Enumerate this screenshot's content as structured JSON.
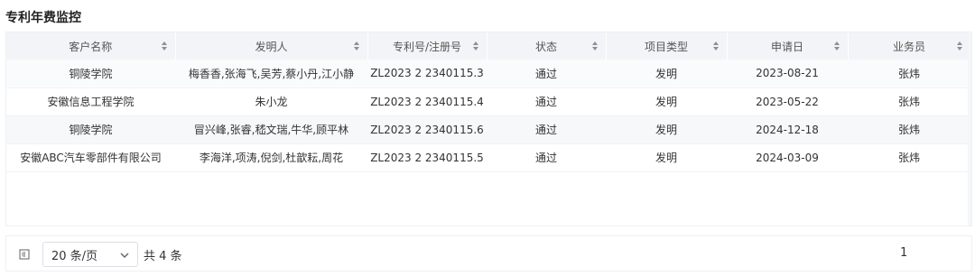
{
  "panel": {
    "title": "专利年费监控"
  },
  "table": {
    "columns": [
      "客户名称",
      "发明人",
      "专利号/注册号",
      "状态",
      "项目类型",
      "申请日",
      "业务员"
    ],
    "rows": [
      [
        "铜陵学院",
        "梅香香,张海飞,吴芳,蔡小丹,江小静",
        "ZL2023 2 2340115.3",
        "通过",
        "发明",
        "2023-08-21",
        "张炜"
      ],
      [
        "安徽信息工程学院",
        "朱小龙",
        "ZL2023 2 2340115.4",
        "通过",
        "发明",
        "2023-05-22",
        "张炜"
      ],
      [
        "铜陵学院",
        "冒兴峰,张睿,嵇文瑞,牛华,顾平林",
        "ZL2023 2 2340115.6",
        "通过",
        "发明",
        "2024-12-18",
        "张炜"
      ],
      [
        "安徽ABC汽车零部件有限公司",
        "李海洋,项涛,倪剑,杜歆耘,周花",
        "ZL2023 2 2340115.5",
        "通过",
        "发明",
        "2024-03-09",
        "张炜"
      ]
    ]
  },
  "pagination": {
    "page_size_label": "20 条/页",
    "total_label": "共 4 条",
    "current_page": "1"
  },
  "icons": {
    "sort": "sort-icon",
    "collapse": "collapse-icon",
    "dropdown": "chevron-down-icon"
  }
}
